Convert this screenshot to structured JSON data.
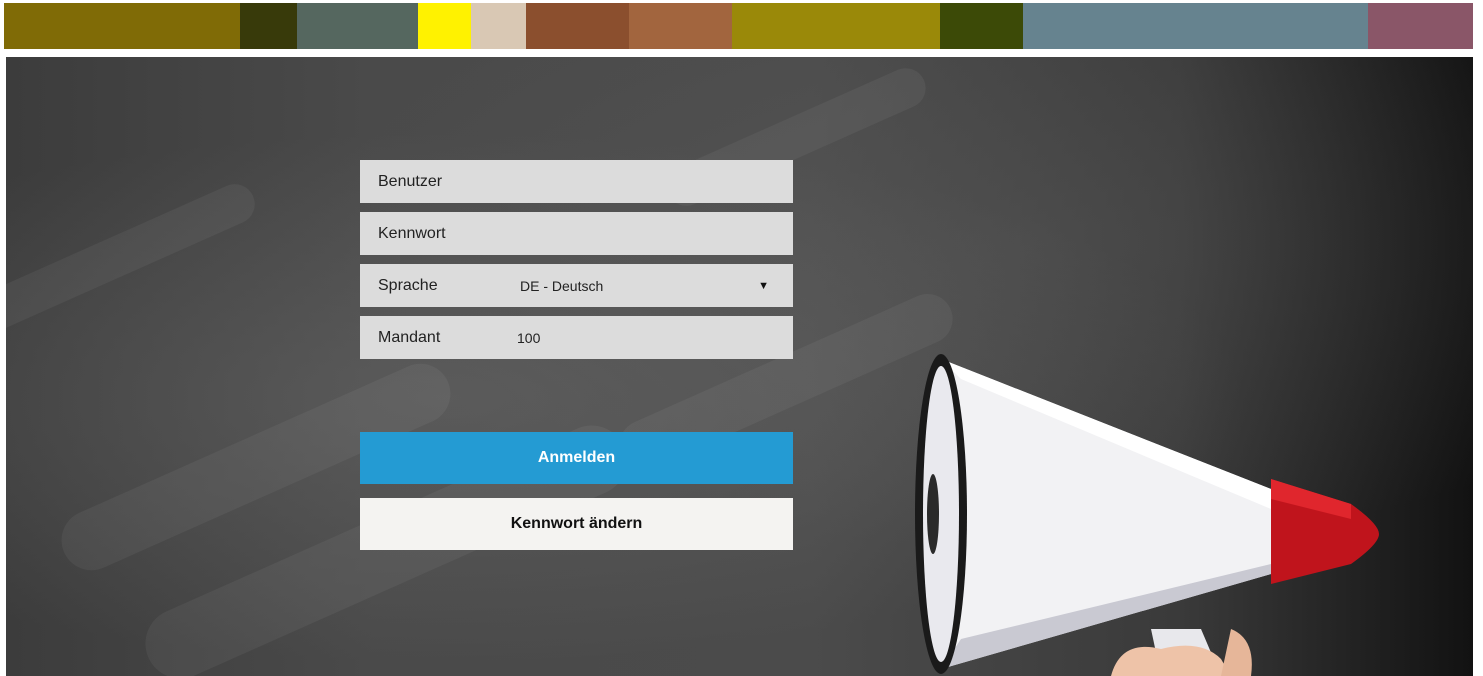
{
  "color_strip": [
    {
      "color": "#806b06",
      "weight": 236
    },
    {
      "color": "#383a0a",
      "weight": 57
    },
    {
      "color": "#55675f",
      "weight": 120
    },
    {
      "color": "#fff200",
      "weight": 53
    },
    {
      "color": "#d9c8b4",
      "weight": 55
    },
    {
      "color": "#8b4f2e",
      "weight": 103
    },
    {
      "color": "#a2653e",
      "weight": 103
    },
    {
      "color": "#9a8909",
      "weight": 208
    },
    {
      "color": "#3c4a07",
      "weight": 83
    },
    {
      "color": "#66838f",
      "weight": 344
    },
    {
      "color": "#8a5668",
      "weight": 105
    }
  ],
  "login": {
    "user_placeholder": "Benutzer",
    "password_placeholder": "Kennwort",
    "language_label": "Sprache",
    "language_value": "DE - Deutsch",
    "client_label": "Mandant",
    "client_value": "100",
    "login_button": "Anmelden",
    "change_password_button": "Kennwort ändern"
  },
  "colors": {
    "accent": "#249bd3",
    "field_bg": "#dcdcdc"
  }
}
